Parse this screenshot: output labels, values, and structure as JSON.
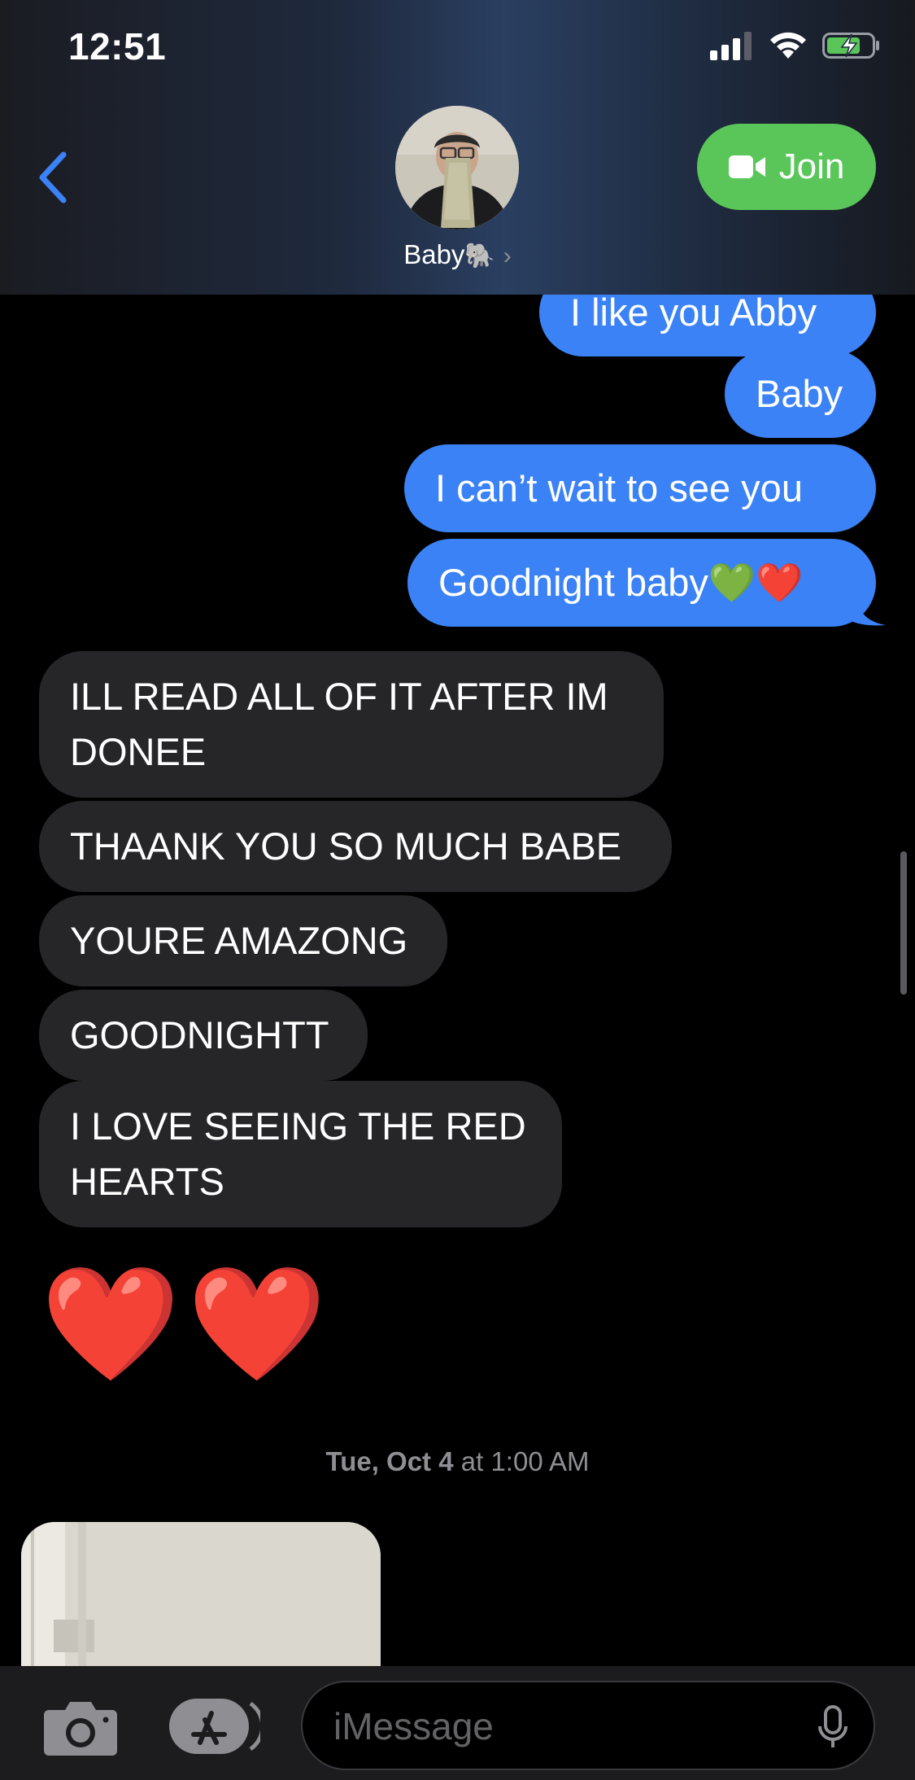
{
  "status_bar": {
    "time": "12:51"
  },
  "header": {
    "contact_name": "Baby",
    "contact_emoji": "🐘",
    "join_label": "Join"
  },
  "messages": [
    {
      "direction": "sent",
      "text": "I like you Abby"
    },
    {
      "direction": "sent",
      "text": "Baby"
    },
    {
      "direction": "sent",
      "text": "I can’t wait to see you"
    },
    {
      "direction": "sent",
      "text": "Goodnight baby💚❤️"
    },
    {
      "direction": "received",
      "text": "ILL READ ALL OF IT AFTER IM DONEE"
    },
    {
      "direction": "received",
      "text": "THAANK YOU SO MUCH BABE"
    },
    {
      "direction": "received",
      "text": "YOURE AMAZONG"
    },
    {
      "direction": "received",
      "text": "GOODNIGHTT"
    },
    {
      "direction": "received",
      "text": "I LOVE SEEING THE RED HEARTS"
    }
  ],
  "big_emoji": "❤️❤️",
  "timestamp": {
    "day": "Tue, Oct 4",
    "time": "at 1:00 AM"
  },
  "input": {
    "placeholder": "iMessage",
    "value": ""
  },
  "icons": [
    "back-chevron-icon",
    "signal-icon",
    "wifi-icon",
    "battery-charging-icon",
    "video-camera-icon",
    "camera-icon",
    "app-store-icon",
    "microphone-icon"
  ],
  "colors": {
    "sent_bubble": "#3b82f6",
    "received_bubble": "#262629",
    "join_button": "#5ac65a",
    "back_chevron": "#3b82f6"
  }
}
